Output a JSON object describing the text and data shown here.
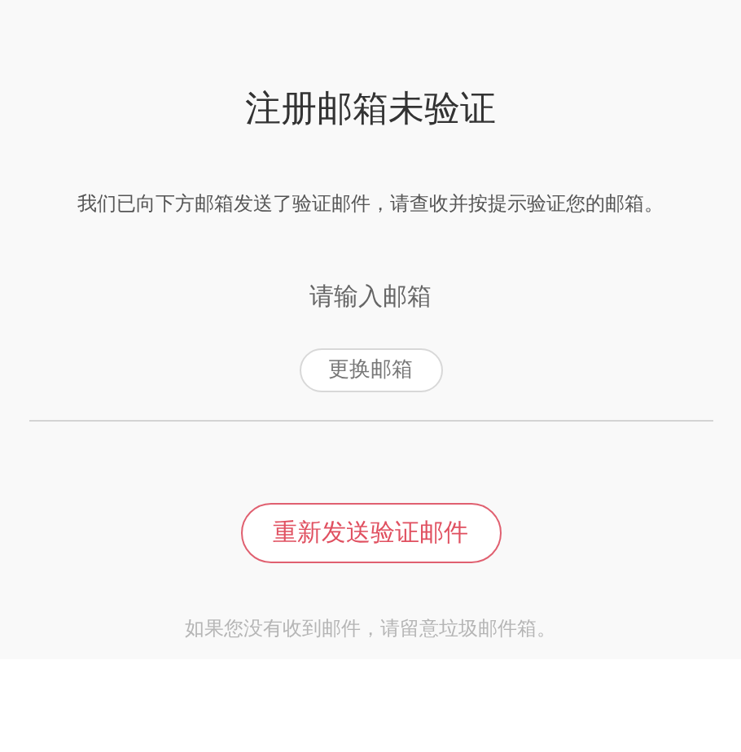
{
  "dialog": {
    "title": "注册邮箱未验证",
    "message": "我们已向下方邮箱发送了验证邮件，请查收并按提示验证您的邮箱。",
    "email": "请输入邮箱",
    "change_button": "更换邮箱",
    "resend_button": "重新发送验证邮件",
    "hint": "如果您没有收到邮件，请留意垃圾邮件箱。"
  }
}
